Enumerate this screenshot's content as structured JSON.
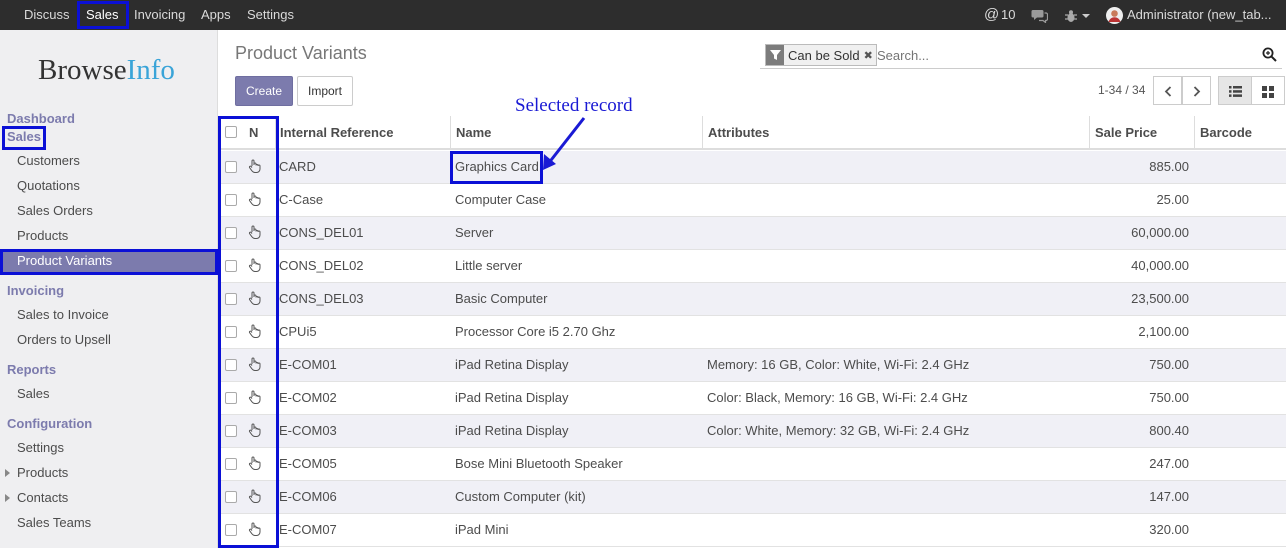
{
  "topbar": {
    "menus": [
      "Discuss",
      "Sales",
      "Invoicing",
      "Apps",
      "Settings"
    ],
    "mentions_count": "10",
    "user": "Administrator (new_tab..."
  },
  "sidebar": {
    "logo_part1": "Browse",
    "logo_part2": "Info",
    "dashboard": "Dashboard",
    "sales_section": "Sales",
    "sales_items": [
      "Customers",
      "Quotations",
      "Sales Orders",
      "Products",
      "Product Variants"
    ],
    "invoicing_section": "Invoicing",
    "invoicing_items": [
      "Sales to Invoice",
      "Orders to Upsell"
    ],
    "reports_section": "Reports",
    "reports_items": [
      "Sales"
    ],
    "config_section": "Configuration",
    "config_items": [
      "Settings",
      "Products",
      "Contacts",
      "Sales Teams"
    ]
  },
  "control": {
    "title": "Product Variants",
    "create_label": "Create",
    "import_label": "Import",
    "facet_label": "Can be Sold",
    "search_placeholder": "Search...",
    "pager": "1-34 / 34"
  },
  "annotation": "Selected record",
  "table": {
    "headers": {
      "n": "N",
      "ref": "Internal Reference",
      "name": "Name",
      "attributes": "Attributes",
      "price": "Sale Price",
      "barcode": "Barcode"
    },
    "rows": [
      {
        "ref": "CARD",
        "name": "Graphics Card",
        "attributes": "",
        "price": "885.00"
      },
      {
        "ref": "C-Case",
        "name": "Computer Case",
        "attributes": "",
        "price": "25.00"
      },
      {
        "ref": "CONS_DEL01",
        "name": "Server",
        "attributes": "",
        "price": "60,000.00"
      },
      {
        "ref": "CONS_DEL02",
        "name": "Little server",
        "attributes": "",
        "price": "40,000.00"
      },
      {
        "ref": "CONS_DEL03",
        "name": "Basic Computer",
        "attributes": "",
        "price": "23,500.00"
      },
      {
        "ref": "CPUi5",
        "name": "Processor Core i5 2.70 Ghz",
        "attributes": "",
        "price": "2,100.00"
      },
      {
        "ref": "E-COM01",
        "name": "iPad Retina Display",
        "attributes": "Memory: 16 GB, Color: White, Wi-Fi: 2.4 GHz",
        "price": "750.00"
      },
      {
        "ref": "E-COM02",
        "name": "iPad Retina Display",
        "attributes": "Color: Black, Memory: 16 GB, Wi-Fi: 2.4 GHz",
        "price": "750.00"
      },
      {
        "ref": "E-COM03",
        "name": "iPad Retina Display",
        "attributes": "Color: White, Memory: 32 GB, Wi-Fi: 2.4 GHz",
        "price": "800.40"
      },
      {
        "ref": "E-COM05",
        "name": "Bose Mini Bluetooth Speaker",
        "attributes": "",
        "price": "247.00"
      },
      {
        "ref": "E-COM06",
        "name": "Custom Computer (kit)",
        "attributes": "",
        "price": "147.00"
      },
      {
        "ref": "E-COM07",
        "name": "iPad Mini",
        "attributes": "",
        "price": "320.00"
      }
    ]
  },
  "colors": {
    "accent": "#7c7bad",
    "highlight": "#0b10d6",
    "topbar": "#2d2d2d"
  }
}
